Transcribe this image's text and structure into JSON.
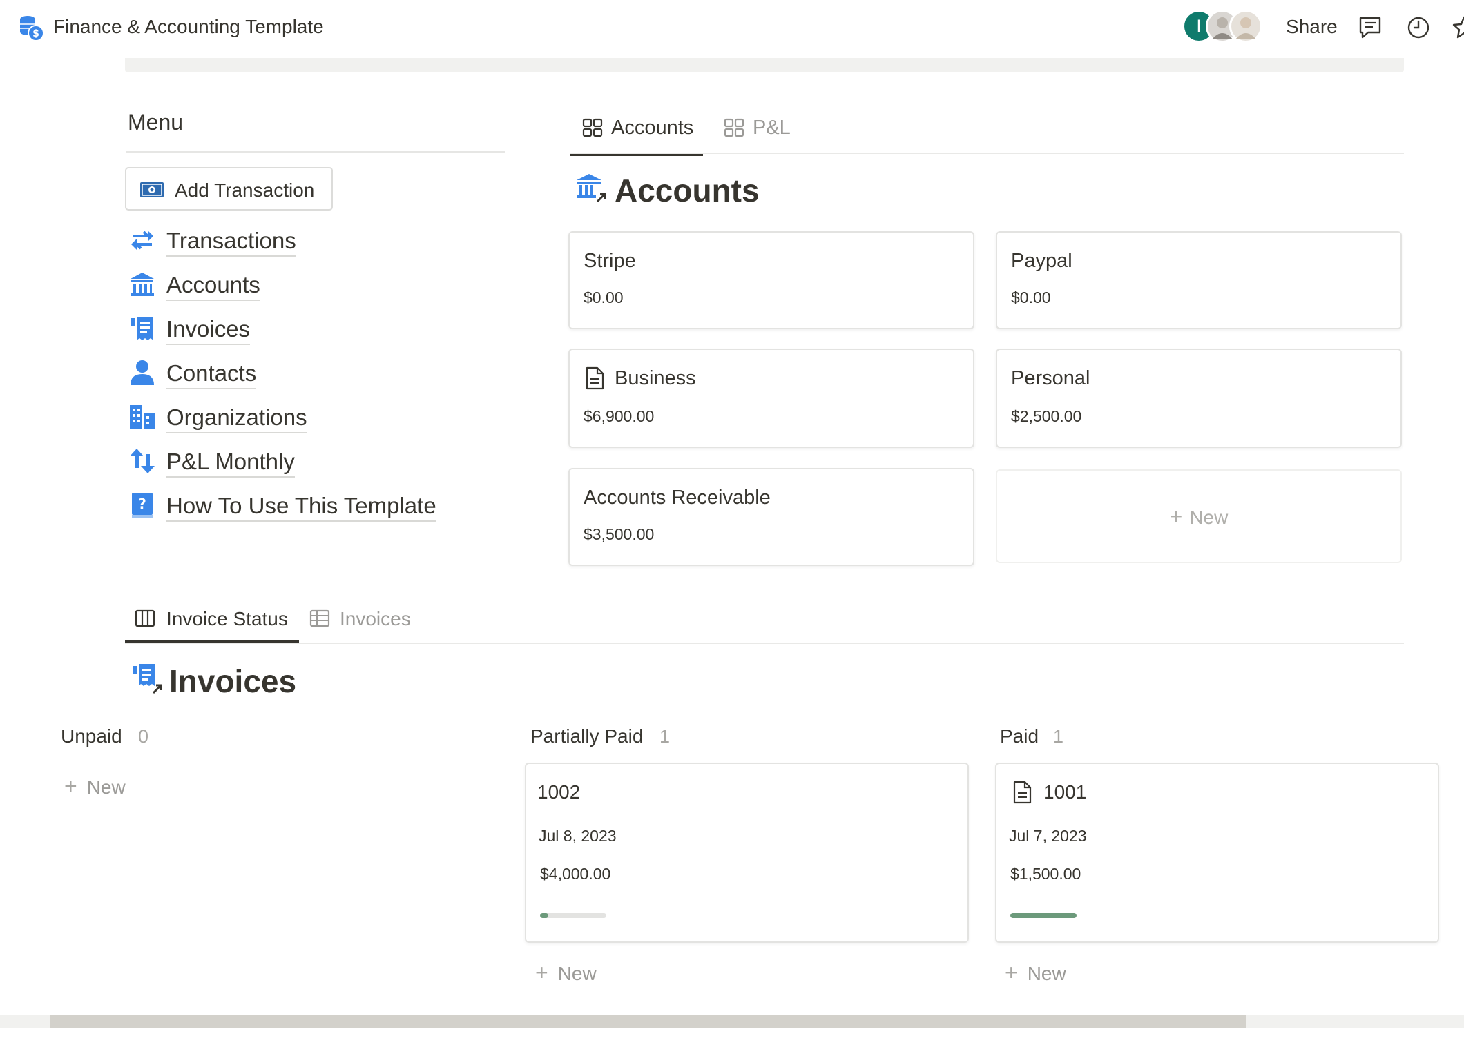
{
  "topbar": {
    "title": "Finance & Accounting Template",
    "avatar_initial": "I",
    "share_label": "Share"
  },
  "menu": {
    "title": "Menu",
    "add_transaction_label": "Add Transaction",
    "items": [
      {
        "label": "Transactions",
        "icon": "arrows-swap-icon"
      },
      {
        "label": "Accounts",
        "icon": "bank-icon"
      },
      {
        "label": "Invoices",
        "icon": "receipt-icon"
      },
      {
        "label": "Contacts",
        "icon": "person-icon"
      },
      {
        "label": "Organizations",
        "icon": "buildings-icon"
      },
      {
        "label": "P&L Monthly",
        "icon": "up-down-arrows-icon"
      },
      {
        "label": "How To Use This Template",
        "icon": "help-book-icon"
      }
    ]
  },
  "accounts_section": {
    "tabs": [
      {
        "label": "Accounts",
        "active": true
      },
      {
        "label": "P&L",
        "active": false
      }
    ],
    "heading": "Accounts",
    "cards": [
      {
        "name": "Stripe",
        "balance": "$0.00"
      },
      {
        "name": "Paypal",
        "balance": "$0.00"
      },
      {
        "name": "Business",
        "balance": "$6,900.00"
      },
      {
        "name": "Personal",
        "balance": "$2,500.00"
      },
      {
        "name": "Accounts Receivable",
        "balance": "$3,500.00"
      }
    ],
    "new_label": "New"
  },
  "invoices_section": {
    "tabs": [
      {
        "label": "Invoice Status",
        "active": true
      },
      {
        "label": "Invoices",
        "active": false
      }
    ],
    "heading": "Invoices",
    "columns": [
      {
        "name": "Unpaid",
        "count": "0",
        "cards": []
      },
      {
        "name": "Partially Paid",
        "count": "1",
        "cards": [
          {
            "number": "1002",
            "date": "Jul 8, 2023",
            "amount": "$4,000.00",
            "paid_fraction": 0.12
          }
        ]
      },
      {
        "name": "Paid",
        "count": "1",
        "cards": [
          {
            "number": "1001",
            "date": "Jul 7, 2023",
            "amount": "$1,500.00",
            "paid_fraction": 1.0
          }
        ]
      }
    ],
    "new_label": "New"
  },
  "colors": {
    "text": "#37352f",
    "accent_blue": "#3a86e8",
    "avatar_green": "#0f7b6c",
    "progress_green": "#6c9a7b"
  }
}
